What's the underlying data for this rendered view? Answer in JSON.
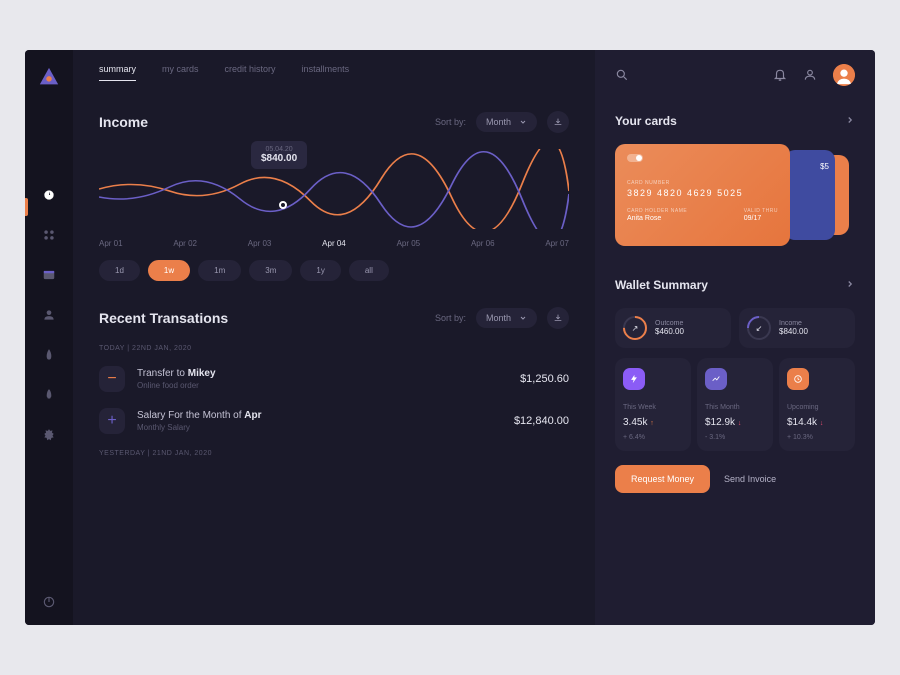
{
  "tabs": [
    "summary",
    "my cards",
    "credit history",
    "installments"
  ],
  "income": {
    "title": "Income",
    "sort_label": "Sort by:",
    "sort_value": "Month",
    "tooltip_date": "05.04.20",
    "tooltip_value": "$840.00",
    "dates": [
      "Apr 01",
      "Apr 02",
      "Apr 03",
      "Apr 04",
      "Apr 05",
      "Apr 06",
      "Apr 07"
    ],
    "ranges": [
      "1d",
      "1w",
      "1m",
      "3m",
      "1y",
      "all"
    ]
  },
  "transactions": {
    "title": "Recent Transations",
    "sort_label": "Sort by:",
    "sort_value": "Month",
    "date1": "TODAY | 22ND JAN, 2020",
    "item1_title": "Transfer to ",
    "item1_bold": "Mikey",
    "item1_sub": "Online food order",
    "item1_amount": "$1,250.60",
    "item2_title": "Salary For the Month of ",
    "item2_bold": "Apr",
    "item2_sub": "Monthly Salary",
    "item2_amount": "$12,840.00",
    "date2": "YESTERDAY | 21ND JAN, 2020"
  },
  "cards": {
    "title": "Your cards",
    "label_number": "CARD NUMBER",
    "number": "3829 4820 4629 5025",
    "label_holder": "CARD HOLDER NAME",
    "holder": "Anita Rose",
    "label_valid": "VALID THRU",
    "valid": "09/17",
    "back_num": "$5"
  },
  "wallet": {
    "title": "Wallet Summary",
    "outcome_label": "Outcome",
    "outcome_value": "$460.00",
    "income_label": "Income",
    "income_value": "$840.00"
  },
  "stats": {
    "week_label": "This Week",
    "week_value": "3.45k",
    "week_change": "+ 6.4%",
    "month_label": "This Month",
    "month_value": "$12.9k",
    "month_change": "- 3.1%",
    "upcoming_label": "Upcoming",
    "upcoming_value": "$14.4k",
    "upcoming_change": "+ 10.3%"
  },
  "actions": {
    "request": "Request Money",
    "send": "Send Invoice"
  },
  "chart_data": {
    "type": "line",
    "title": "Income",
    "xlabel": "",
    "ylabel": "",
    "categories": [
      "Apr 01",
      "Apr 02",
      "Apr 03",
      "Apr 04",
      "Apr 05",
      "Apr 06",
      "Apr 07"
    ],
    "series": [
      {
        "name": "orange",
        "values": [
          820,
          780,
          900,
          840,
          880,
          790,
          850
        ]
      },
      {
        "name": "purple",
        "values": [
          760,
          850,
          810,
          870,
          800,
          860,
          810
        ]
      }
    ],
    "highlight": {
      "category": "Apr 04",
      "value": 840,
      "date": "05.04.20"
    }
  }
}
